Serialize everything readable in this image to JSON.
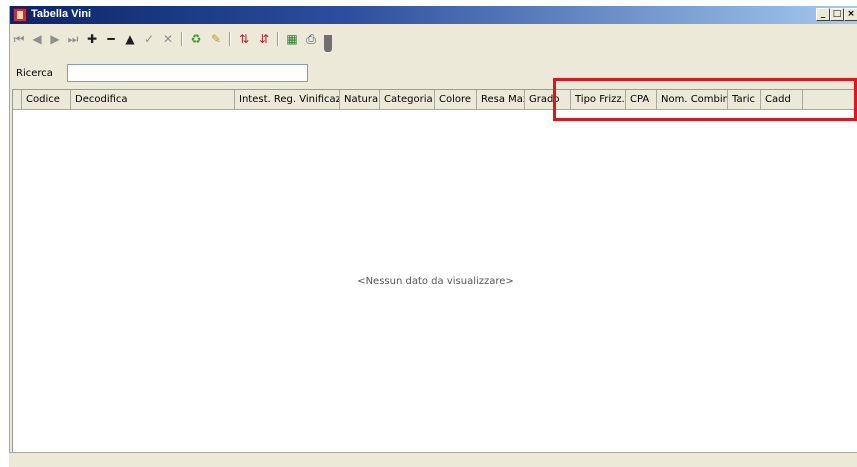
{
  "window": {
    "title": "Tabella Vini",
    "controls": {
      "minimize": "_",
      "maximize": "□",
      "close": "×"
    }
  },
  "toolbar": {
    "buttons": [
      {
        "name": "first-record-button",
        "glyph": "⏮"
      },
      {
        "name": "prev-record-button",
        "glyph": "◀"
      },
      {
        "name": "next-record-button",
        "glyph": "▶"
      },
      {
        "name": "last-record-button",
        "glyph": "⏭"
      },
      {
        "name": "add-button",
        "glyph": "✚"
      },
      {
        "name": "remove-button",
        "glyph": "━"
      },
      {
        "name": "edit-button",
        "glyph": "▲"
      },
      {
        "name": "confirm-button",
        "glyph": "✓"
      },
      {
        "name": "cancel-button",
        "glyph": "✕"
      },
      {
        "name": "refresh-button",
        "glyph": "♻"
      },
      {
        "name": "filter-button",
        "glyph": "✎"
      },
      {
        "name": "sort-asc-button",
        "glyph": "⇅"
      },
      {
        "name": "sort-desc-button",
        "glyph": "⇵"
      },
      {
        "name": "export-excel-button",
        "glyph": "▦"
      },
      {
        "name": "print-button",
        "glyph": "⎙"
      }
    ]
  },
  "search": {
    "label": "Ricerca",
    "value": "",
    "placeholder": ""
  },
  "grid": {
    "columns": [
      "Codice",
      "Decodifica",
      "Intest. Reg. Vinificazione",
      "Natura",
      "Categoria",
      "Colore",
      "Resa Max",
      "Grado",
      "Tipo Frizz.",
      "CPA",
      "Nom. Combin.",
      "Taric",
      "Cadd"
    ],
    "rows": [],
    "empty_message": "<Nessun dato da visualizzare>"
  },
  "colors": {
    "highlight": "#e0141e",
    "titlebar": "#0a246a"
  }
}
